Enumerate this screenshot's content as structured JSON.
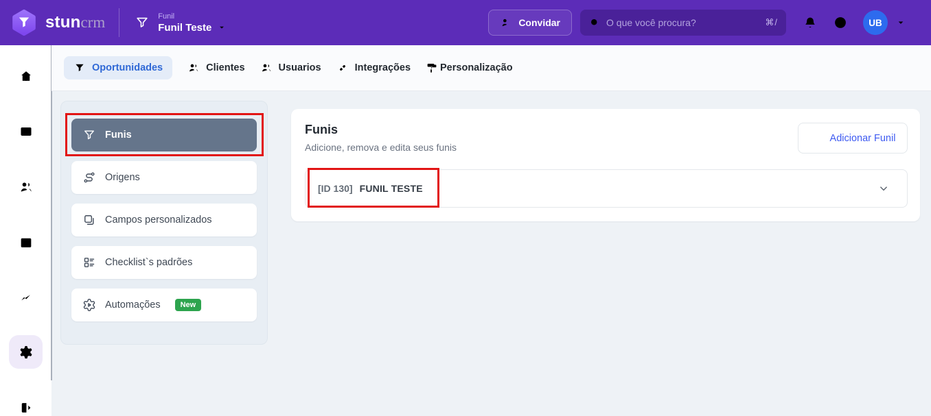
{
  "header": {
    "brand": {
      "name": "stun",
      "suffix": "crm"
    },
    "funnel_selector": {
      "label": "Funil",
      "value": "Funil Teste"
    },
    "invite_button": "Convidar",
    "search": {
      "placeholder": "O que você procura?",
      "shortcut": "⌘/"
    },
    "avatar_initials": "UB"
  },
  "tabs": [
    {
      "label": "Oportunidades",
      "active": true
    },
    {
      "label": "Clientes"
    },
    {
      "label": "Usuarios"
    },
    {
      "label": "Integrações"
    },
    {
      "label": "Personalização"
    }
  ],
  "settings_menu": [
    {
      "label": "Funis",
      "selected": true
    },
    {
      "label": "Origens"
    },
    {
      "label": "Campos personalizados"
    },
    {
      "label": "Checklist`s padrões"
    },
    {
      "label": "Automações",
      "badge": "New"
    }
  ],
  "main": {
    "title": "Funis",
    "subtitle": "Adicione, remova e edita seus funis",
    "add_button": "Adicionar Funil",
    "funnels": [
      {
        "id_label": "[ID 130]",
        "name": "FUNIL TESTE"
      }
    ]
  },
  "colors": {
    "header_bg": "#5C2CB8",
    "search_bg": "#4A2199",
    "logo_purple": "#8F63F8",
    "accent_blue": "#3069D6",
    "link_blue": "#3D5AF1",
    "selected_item_bg": "#65758B",
    "badge_green": "#2DA44E",
    "annotation_red": "#E21414",
    "avatar_blue": "#2D6BEE"
  }
}
